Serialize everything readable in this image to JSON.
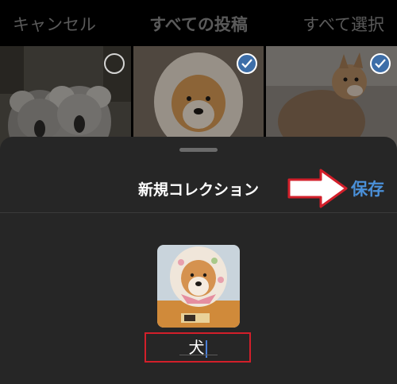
{
  "topbar": {
    "cancel_label": "キャンセル",
    "title": "すべての投稿",
    "select_all_label": "すべて選択"
  },
  "grid": {
    "items": [
      {
        "subject": "koala",
        "selected": false
      },
      {
        "subject": "shiba-dog-hood",
        "selected": true
      },
      {
        "subject": "wet-dog",
        "selected": true
      }
    ]
  },
  "sheet": {
    "title": "新規コレクション",
    "save_label": "保存",
    "collection_name": "犬"
  },
  "colors": {
    "accent": "#4a90d9",
    "highlight_box": "#d21f2a",
    "sheet_bg": "#262626",
    "check_fill": "#3d6ea8"
  }
}
